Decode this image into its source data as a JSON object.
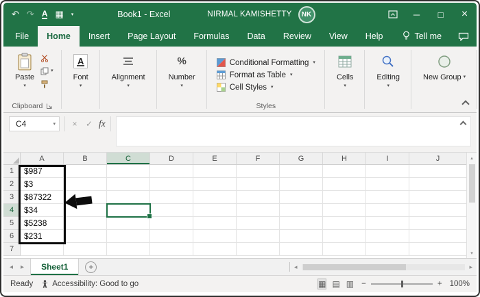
{
  "colors": {
    "excel_green": "#217346",
    "selection_green": "#1e7145",
    "annotation_black": "#0c0c0c"
  },
  "titlebar": {
    "title": "Book1 - Excel",
    "user_name": "NIRMAL KAMISHETTY",
    "user_initials": "NK"
  },
  "tabs": {
    "items": [
      "File",
      "Home",
      "Insert",
      "Page Layout",
      "Formulas",
      "Data",
      "Review",
      "View",
      "Help"
    ],
    "tell_me": "Tell me"
  },
  "ribbon": {
    "clipboard": {
      "paste_label": "Paste",
      "group_label": "Clipboard"
    },
    "font": {
      "label": "Font"
    },
    "alignment": {
      "label": "Alignment"
    },
    "number": {
      "label": "Number"
    },
    "styles": {
      "rows": [
        "Conditional Formatting",
        "Format as Table",
        "Cell Styles"
      ],
      "group_label": "Styles"
    },
    "cells": {
      "label": "Cells"
    },
    "editing": {
      "label": "Editing"
    },
    "new_group": {
      "label": "New Group"
    }
  },
  "formula_bar": {
    "name_box": "C4",
    "fx": "fx",
    "value": ""
  },
  "grid": {
    "columns": [
      "A",
      "B",
      "C",
      "D",
      "E",
      "F",
      "G",
      "H",
      "I",
      "J"
    ],
    "rows": [
      "1",
      "2",
      "3",
      "4",
      "5",
      "6",
      "7"
    ],
    "a_values": [
      "$987",
      "$3",
      "$87322",
      "$34",
      "$5238",
      "$231"
    ],
    "selected_cell": "C4"
  },
  "sheet_bar": {
    "sheet": "Sheet1"
  },
  "status_bar": {
    "mode": "Ready",
    "accessibility": "Accessibility: Good to go",
    "zoom": "100%"
  },
  "icons": {
    "undo": "↶",
    "redo": "↷",
    "underline_a": "A",
    "qat_grid": "▦",
    "small_caret": "▾",
    "minimize": "─",
    "maximize": "□",
    "close": "×",
    "cancel": "×",
    "enter": "✓",
    "percent": "%",
    "font_a": "A",
    "left": "◂",
    "right": "▸",
    "up": "▴",
    "down": "▾",
    "plus": "+",
    "zoom_out": "−",
    "zoom_in": "+",
    "view_normal": "▦",
    "view_layout": "▤",
    "view_break": "▥"
  }
}
